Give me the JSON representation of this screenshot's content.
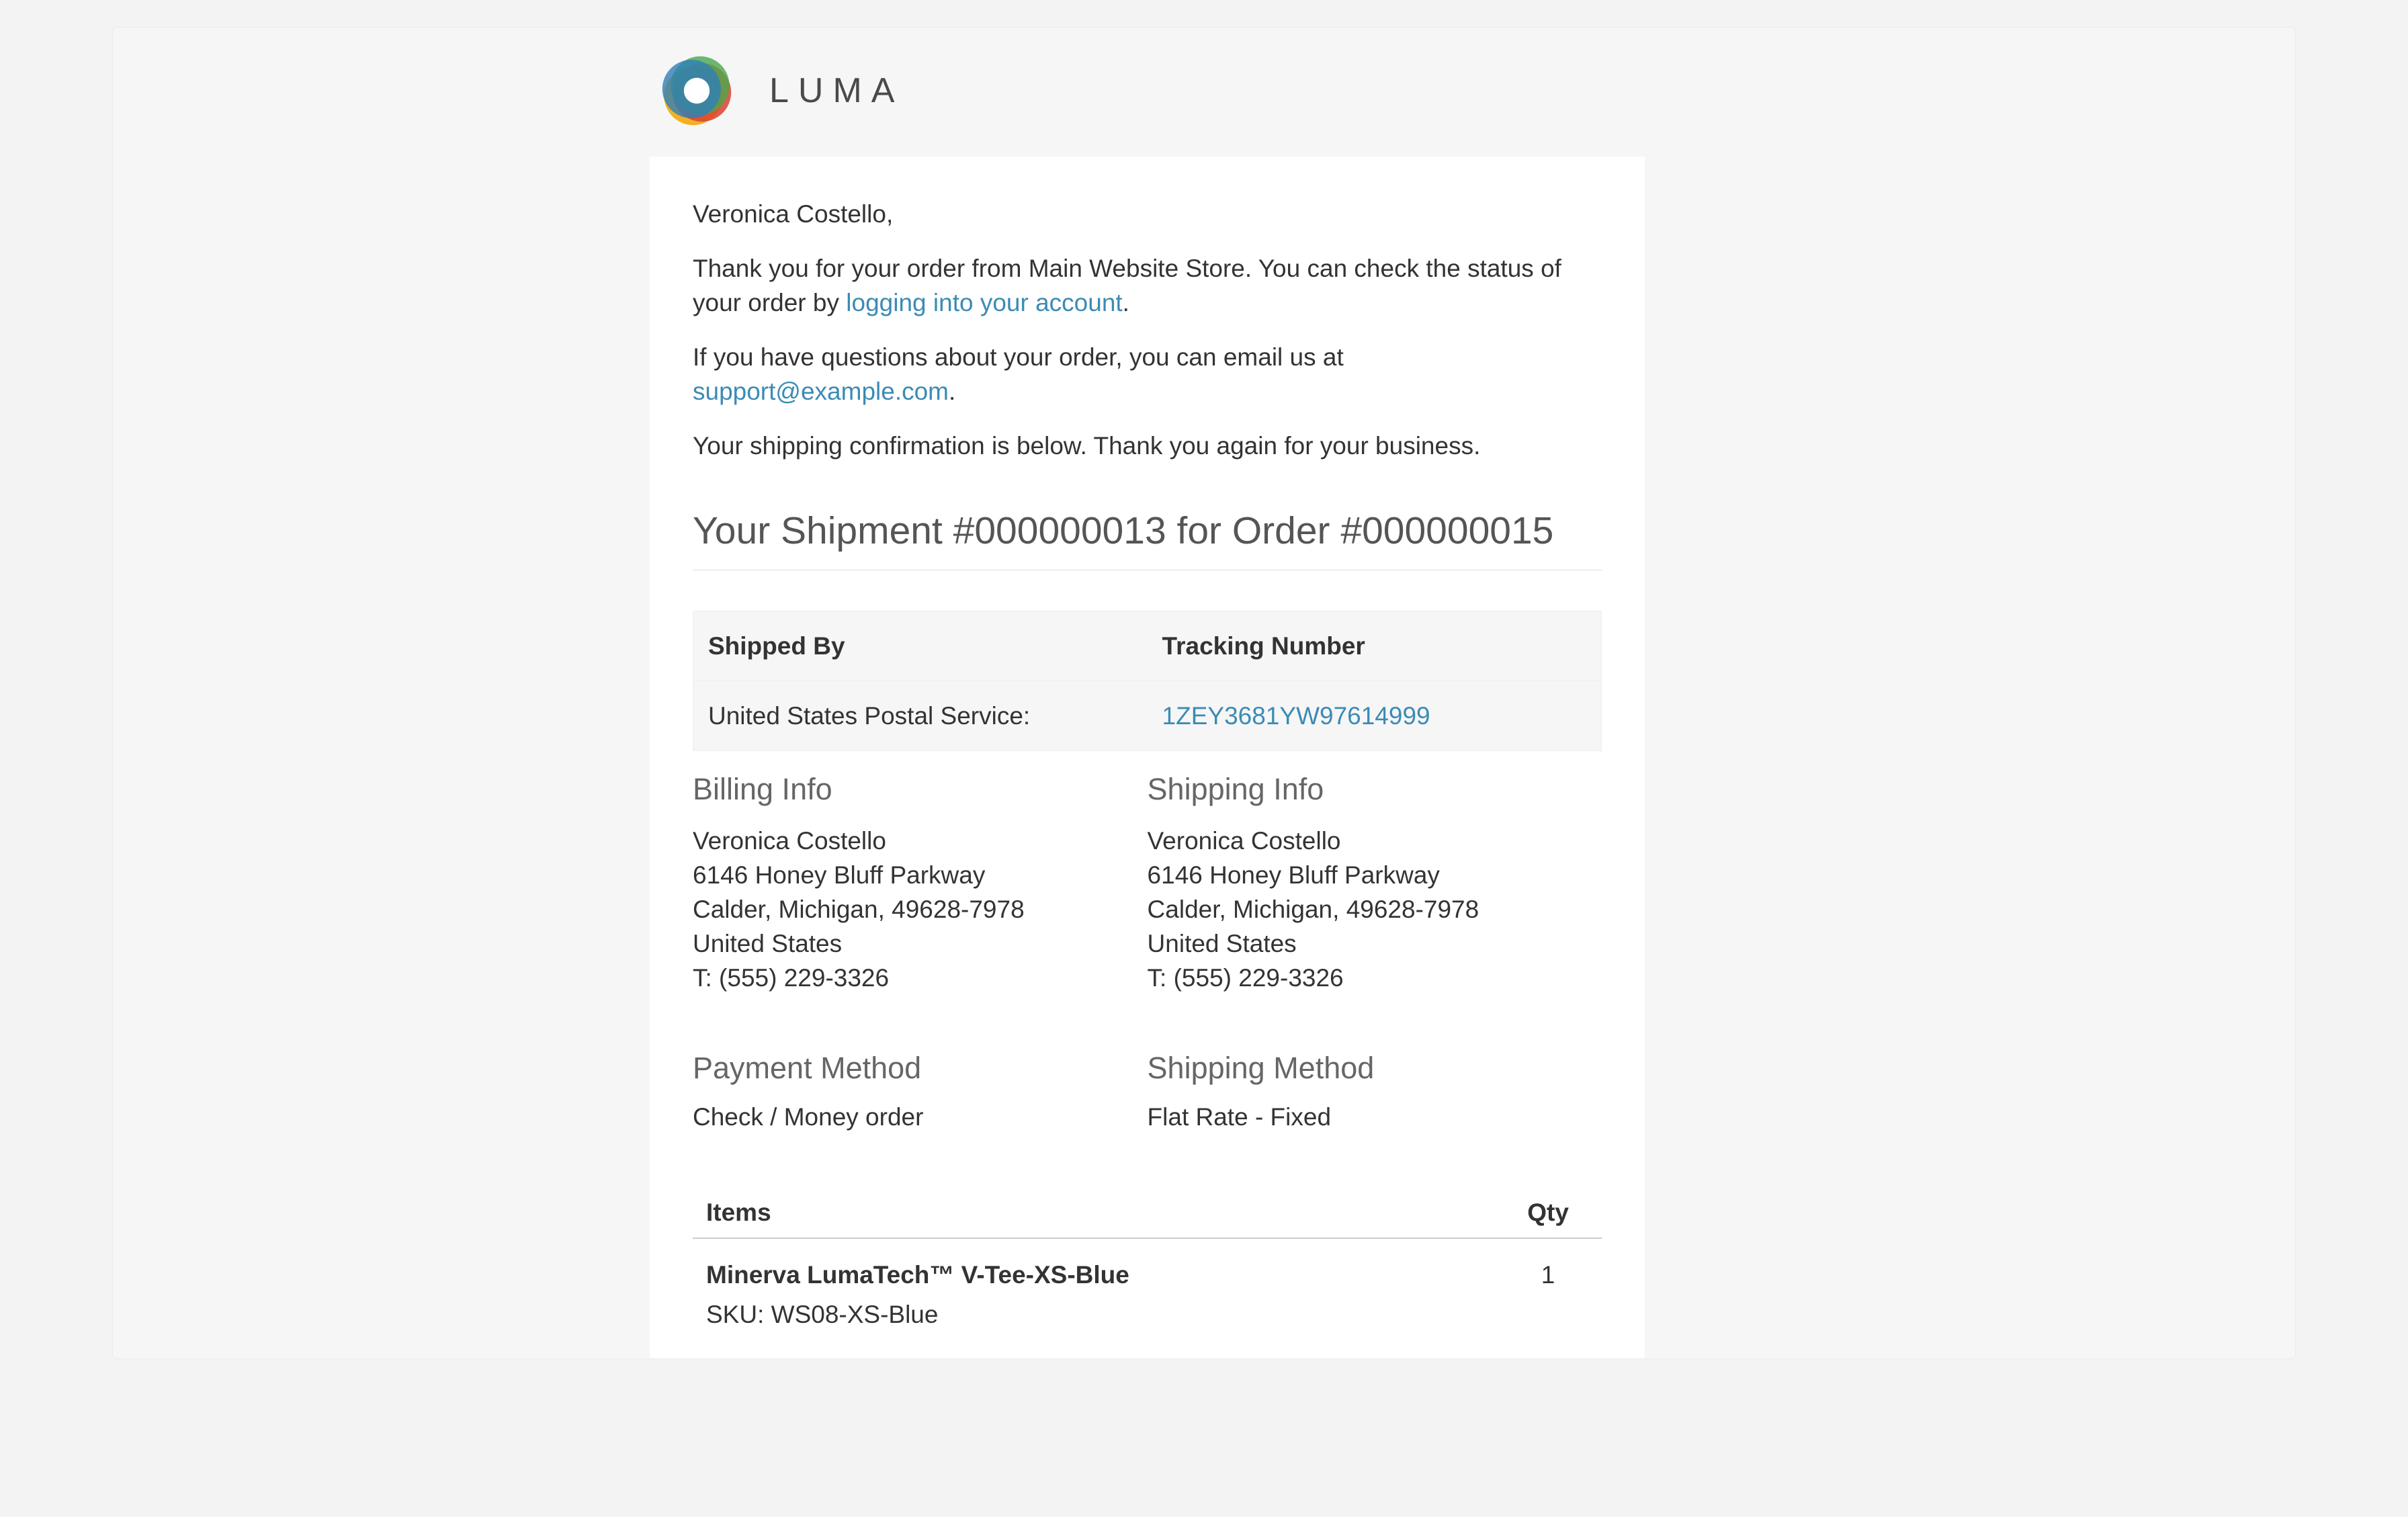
{
  "brand": {
    "name": "LUMA"
  },
  "greeting": "Veronica Costello,",
  "intro": {
    "thanks_pre": "Thank you for your order from Main Website Store. You can check the status of your order by ",
    "login_link": "logging into your account",
    "thanks_post": "."
  },
  "questions": {
    "pre": "If you have questions about your order, you can email us at ",
    "email": "support@example.com",
    "post": "."
  },
  "confirmation_line": "Your shipping confirmation is below. Thank you again for your business.",
  "shipment_title": "Your Shipment #000000013 for Order #000000015",
  "tracking": {
    "head_carrier": "Shipped By",
    "head_number": "Tracking Number",
    "carrier": "United States Postal Service:",
    "number": "1ZEY3681YW97614999"
  },
  "billing": {
    "heading": "Billing Info",
    "name": "Veronica Costello",
    "street": "6146 Honey Bluff Parkway",
    "city_line": "Calder, Michigan, 49628-7978",
    "country": "United States",
    "phone": "T: (555) 229-3326"
  },
  "shipping": {
    "heading": "Shipping Info",
    "name": "Veronica Costello",
    "street": "6146 Honey Bluff Parkway",
    "city_line": "Calder, Michigan, 49628-7978",
    "country": "United States",
    "phone": "T: (555) 229-3326"
  },
  "payment": {
    "heading": "Payment Method",
    "value": "Check / Money order"
  },
  "ship_method": {
    "heading": "Shipping Method",
    "value": "Flat Rate - Fixed"
  },
  "items": {
    "head_items": "Items",
    "head_qty": "Qty",
    "rows": [
      {
        "name": "Minerva LumaTech™ V-Tee-XS-Blue",
        "sku_label": "SKU: ",
        "sku": "WS08-XS-Blue",
        "qty": "1"
      }
    ]
  }
}
